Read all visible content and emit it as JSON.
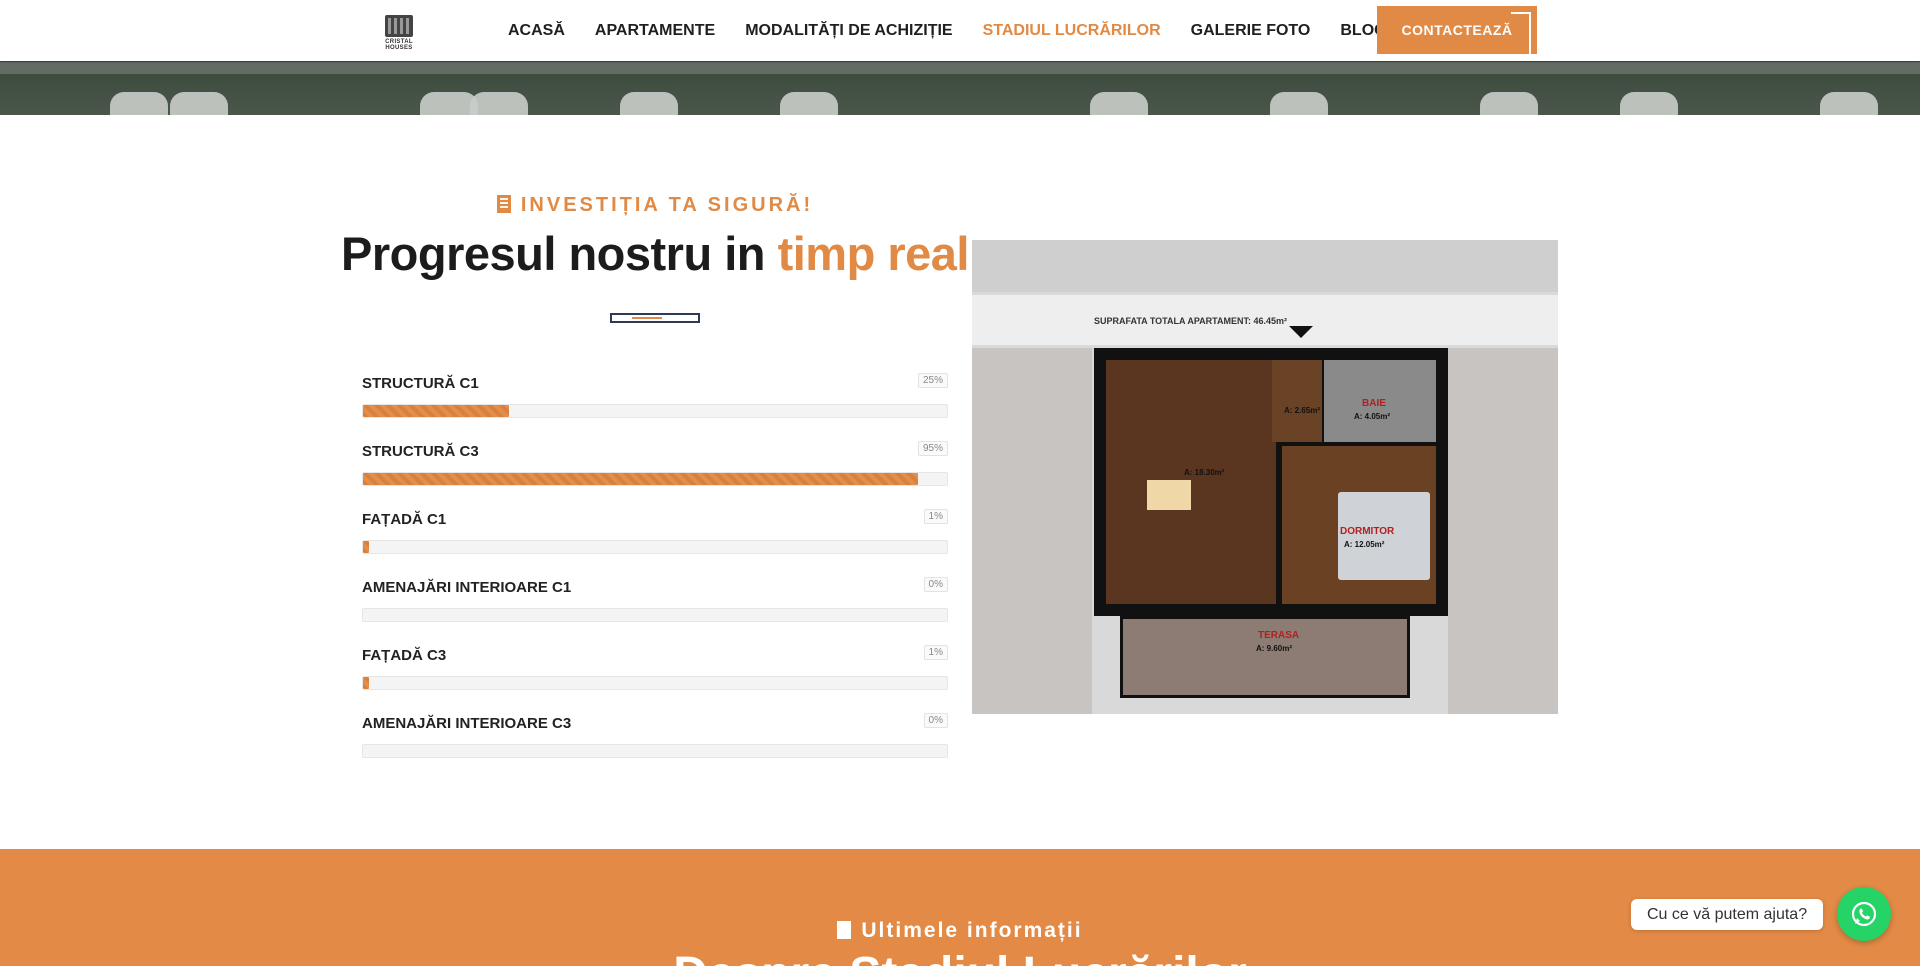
{
  "brand": {
    "logo_text": "CRISTAL HOUSES"
  },
  "nav": {
    "items": [
      {
        "label": "ACASĂ"
      },
      {
        "label": "APARTAMENTE"
      },
      {
        "label": "MODALITĂȚI DE ACHIZIȚIE"
      },
      {
        "label": "STADIUL LUCRĂRILOR",
        "active": true
      },
      {
        "label": "GALERIE FOTO"
      },
      {
        "label": "BLOG"
      }
    ],
    "cta_label": "CONTACTEAZĂ"
  },
  "section": {
    "eyebrow": "INVESTIȚIA TA SIGURĂ!",
    "title_main": "Progresul nostru in ",
    "title_accent": "timp real"
  },
  "progress": [
    {
      "label": "STRUCTURĂ C1",
      "percent_text": "25%",
      "value": 25
    },
    {
      "label": "STRUCTURĂ C3",
      "percent_text": "95%",
      "value": 95
    },
    {
      "label": "FAȚADĂ C1",
      "percent_text": "1%",
      "value": 1
    },
    {
      "label": "AMENAJĂRI INTERIOARE C1",
      "percent_text": "0%",
      "value": 0
    },
    {
      "label": "FAȚADĂ C3",
      "percent_text": "1%",
      "value": 1
    },
    {
      "label": "AMENAJĂRI INTERIOARE C3",
      "percent_text": "0%",
      "value": 0
    }
  ],
  "floor_plan": {
    "total_area": "SUPRAFATA TOTALA APARTAMENT: 46.45m²",
    "rooms": [
      {
        "name": "",
        "area": "A: 18.30m²"
      },
      {
        "name": "BAIE",
        "area": "A: 4.05m²"
      },
      {
        "name": "",
        "area": "A: 2.65m²"
      },
      {
        "name": "DORMITOR",
        "area": "A: 12.05m²"
      },
      {
        "name": "TERASA",
        "area": "A: 9.60m²"
      }
    ]
  },
  "bottom": {
    "eyebrow": "Ultimele informații",
    "heading": "Despre Stadiul Lucrărilor"
  },
  "chat": {
    "prompt": "Cu ce vă putem ajuta?"
  },
  "colors": {
    "accent": "#e08a45",
    "dark": "#1c1c1c",
    "navy": "#2d3a55",
    "whatsapp": "#25d366"
  }
}
